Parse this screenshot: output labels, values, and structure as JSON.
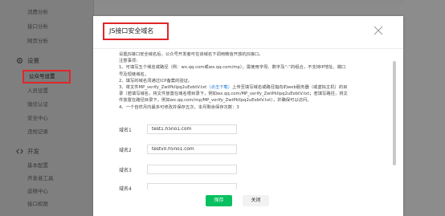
{
  "sidebar": {
    "top_items": [
      "消费分析",
      "接口分析",
      "网页分析"
    ],
    "settings_section": "设置",
    "settings_items": [
      "公众号设置",
      "人员设置",
      "微信认证",
      "安全中心",
      "违规记录"
    ],
    "dev_section": "开发",
    "dev_items": [
      "基本配置",
      "开发者工具",
      "运维中心",
      "接口权限"
    ]
  },
  "modal": {
    "title": "JS接口安全域名",
    "info_lines": [
      "设置JS接口安全域名后，公众号开发者可在该域名下调用微信开放的JS接口。",
      "注意事项：",
      "1、可填写五个域名或路径（例：wx.qq.com或wx.qq.com/mp），需使用字母、数字及“-”的组合，不支持IP地址、端口",
      "号及短链域名。",
      "2、填写的域名须通过ICP备案的验证。",
      "3、将文件MP_verify_ZwtPkllpq2uEebtV.txt（点击下载）上传至填写域名或路径指向的web服务器（或虚拟主机）的目",
      "录（若填写域名，将文件放置在域名根目录下，例如wx.qq.com/MP_verify_ZwtPkllpq2uEebtV.txt；若填写路径，将文",
      "件放置在路径目录下，例如wx.qq.com/mp/MP_verify_ZwtPkllpq2uEebtV.txt），并确保可以访问。",
      "4、一个自然月内最多可修改并保存五次，本月剩余保存次数：3"
    ],
    "fields": [
      {
        "label": "域名1",
        "value": "test1.h5no1.com"
      },
      {
        "label": "域名2",
        "value": "testv0.h5no1.com"
      },
      {
        "label": "域名3",
        "value": ""
      },
      {
        "label": "域名4",
        "value": ""
      }
    ],
    "save_label": "保存",
    "close_label": "关闭"
  }
}
